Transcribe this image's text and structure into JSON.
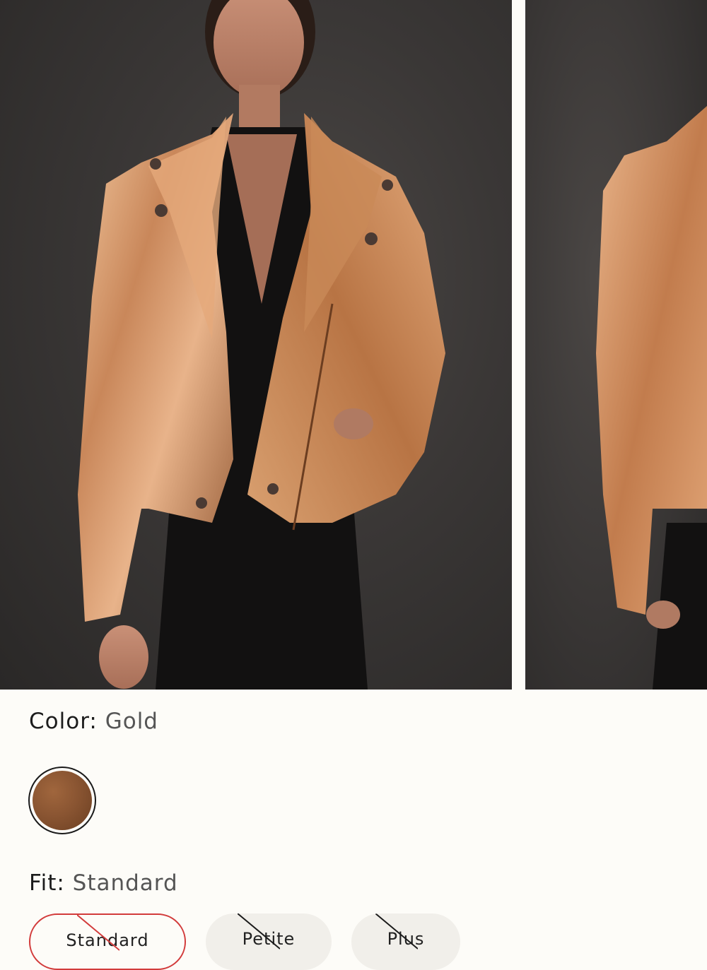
{
  "product": {
    "colors": {
      "swatch": "#8a5532",
      "selected_border": "#d23b3b",
      "strike_out_of_stock": "#1a1a1a"
    }
  },
  "color_selector": {
    "label": "Color:",
    "selected_value": "Gold"
  },
  "fit_selector": {
    "label": "Fit:",
    "selected_value": "Standard",
    "options": [
      {
        "label": "Standard",
        "selected": true,
        "unavailable": true
      },
      {
        "label": "Petite",
        "selected": false,
        "unavailable": true
      },
      {
        "label": "Plus",
        "selected": false,
        "unavailable": true
      }
    ]
  }
}
